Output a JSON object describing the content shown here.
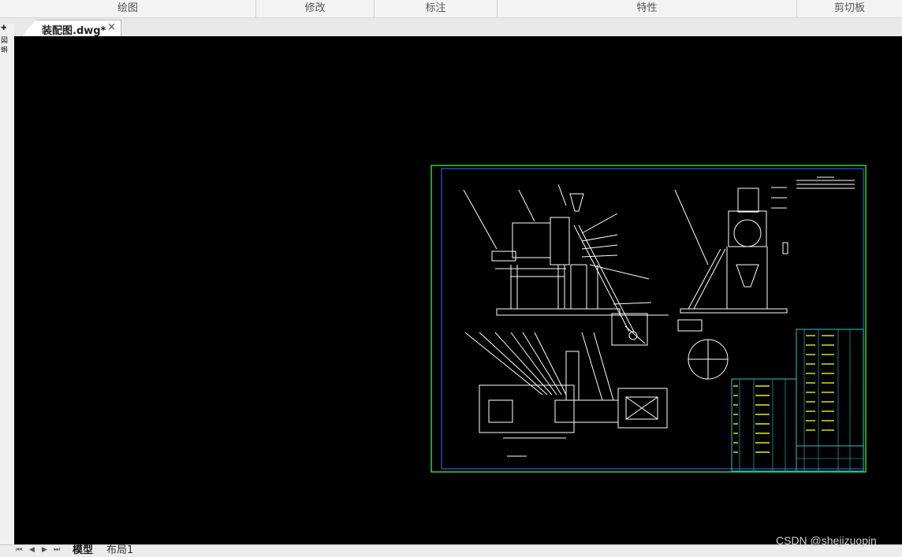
{
  "ribbon": {
    "groups": [
      "绘图",
      "修改",
      "标注",
      "特性",
      "剪切板"
    ]
  },
  "document_tab": {
    "title": "装配图.dwg*",
    "close_glyph": "×"
  },
  "left_strip": {
    "glyphs": [
      "✚",
      "図",
      "蝌"
    ]
  },
  "layout_tabs": {
    "nav": [
      "⏮",
      "◀",
      "▶",
      "⏭"
    ],
    "tabs": [
      "模型",
      "布局1"
    ],
    "active": "模型"
  },
  "watermark": "CSDN @shejizuopin",
  "colors": {
    "canvas_bg": "#000000",
    "sheet_border": "#2fd22f",
    "inner_frame": "#3a6dff",
    "linework": "#ffffff",
    "table_lines": "#27c8c8",
    "table_text": "#e8f000"
  }
}
